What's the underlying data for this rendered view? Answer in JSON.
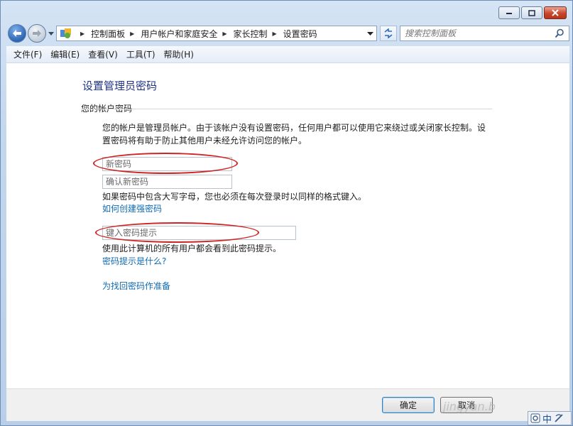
{
  "navigation": {
    "breadcrumbs": [
      "控制面板",
      "用户帐户和家庭安全",
      "家长控制",
      "设置密码"
    ],
    "search_placeholder": "搜索控制面板"
  },
  "menubar": {
    "items": [
      "文件(F)",
      "编辑(E)",
      "查看(V)",
      "工具(T)",
      "帮助(H)"
    ]
  },
  "main": {
    "title": "设置管理员密码",
    "section_label": "您的帐户密码",
    "description": "您的帐户是管理员帐户。由于该帐户没有设置密码，任何用户都可以使用它来绕过或关闭家长控制。设置密码将有助于防止其他用户未经允许访问您的帐户。",
    "new_password_placeholder": "新密码",
    "confirm_password_placeholder": "确认新密码",
    "case_note": "如果密码中包含大写字母，您也必须在每次登录时以同样的格式键入。",
    "strong_password_link": "如何创建强密码",
    "hint_placeholder": "键入密码提示",
    "hint_note": "使用此计算机的所有用户都会看到此密码提示。",
    "hint_help_link": "密码提示是什么?",
    "recovery_link": "为找回密码作准备"
  },
  "footer": {
    "ok_label": "确定",
    "cancel_label": "取消",
    "watermark": "jingyan.b"
  },
  "ime": {
    "label": "中"
  },
  "colors": {
    "title": "#1e3287",
    "link": "#0f6bb3",
    "annotation_circle": "#d02424"
  }
}
